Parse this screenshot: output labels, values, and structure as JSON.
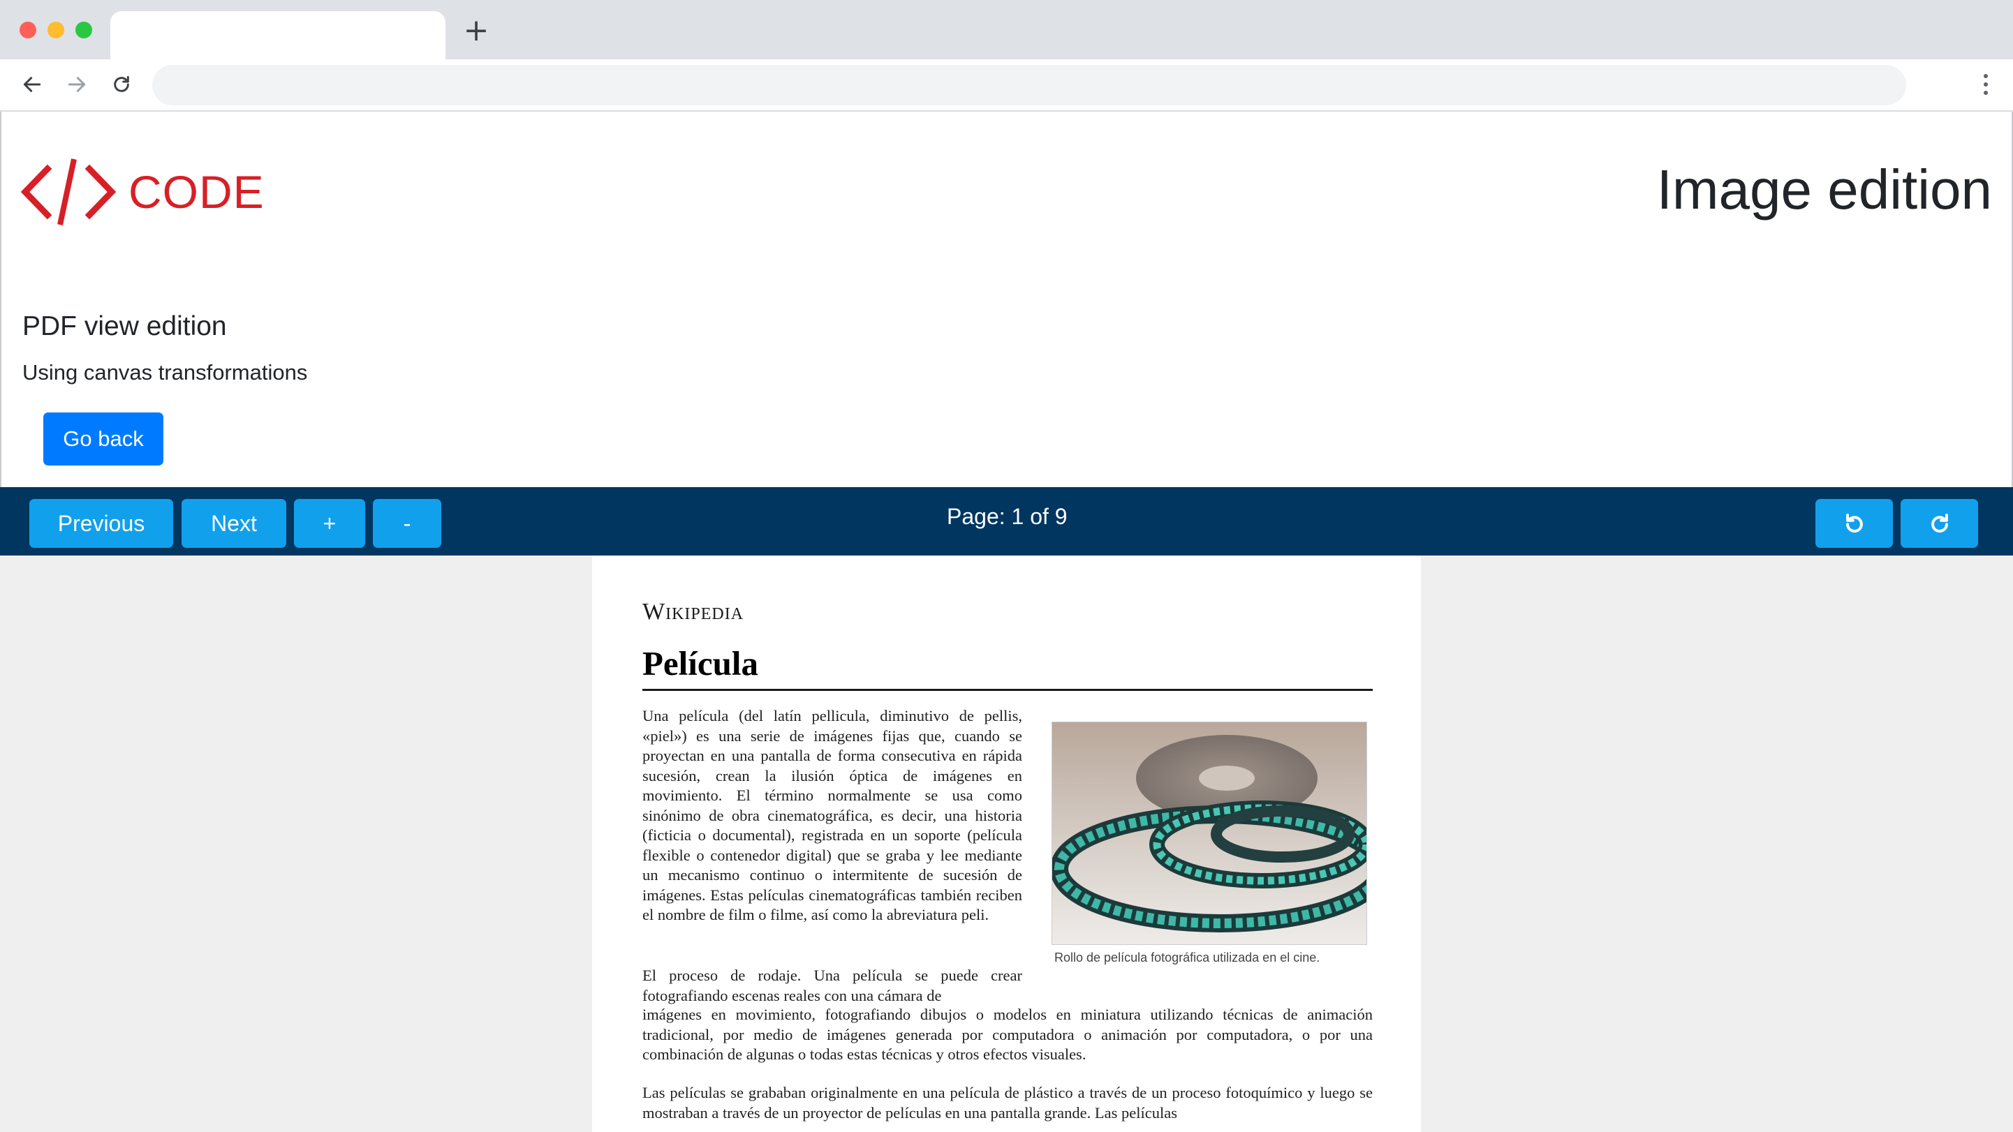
{
  "browser": {
    "tab_title": "",
    "new_tab": "+",
    "address": ""
  },
  "header": {
    "logo_text": "CODE",
    "page_title": "Image edition"
  },
  "section": {
    "title": "PDF view edition",
    "subtitle": "Using canvas transformations",
    "go_back_label": "Go back"
  },
  "pdf_toolbar": {
    "previous_label": "Previous",
    "next_label": "Next",
    "zoom_in_label": "+",
    "zoom_out_label": "-",
    "page_indicator": "Page: 1 of 9",
    "rotate_left_icon": "rotate-left-icon",
    "rotate_right_icon": "rotate-right-icon"
  },
  "document": {
    "brand": "Wikipedia",
    "title": "Película",
    "paragraph1": "Una película (del latín pellicula, diminutivo de pellis, «piel») es una serie de imágenes fijas que, cuando se proyectan en una pantalla de forma consecutiva en rápida sucesión, crean la ilusión óptica de imágenes en movimiento. El término normalmente se usa como sinónimo de obra cinematográfica, es decir, una historia (ficticia o documental), registrada en un soporte (película flexible o contenedor digital) que se graba y lee mediante un mecanismo continuo o intermitente de sucesión de imágenes. Estas películas cinematográficas también reciben el nombre de film o filme, así como la abreviatura peli.",
    "paragraph2_start": "El proceso de rodaje. Una película se puede crear fotografiando escenas reales con una cámara de",
    "paragraph2_end": "imágenes en movimiento, fotografiando dibujos o modelos en miniatura utilizando técnicas de animación tradicional, por medio de imágenes generada por computadora o animación por computadora, o por una combinación de algunas o todas estas técnicas y otros efectos visuales.",
    "paragraph3": "Las películas se grababan originalmente en una película de plástico a través de un proceso fotoquímico y luego se mostraban a través de un proyector de películas en una pantalla grande. Las películas",
    "figure_caption": "Rollo de película fotográfica utilizada en el cine."
  },
  "colors": {
    "brand_red": "#d81f26",
    "primary_button": "#007bff",
    "toolbar_bg": "#003660",
    "toolbar_button": "#11a0ec",
    "viewer_bg": "#efefef"
  }
}
